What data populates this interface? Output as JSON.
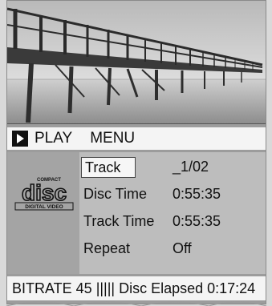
{
  "transport": {
    "state_label": "PLAY",
    "menu_label": "MENU",
    "state_icon": "play-icon"
  },
  "logo": {
    "top_text": "COMPACT",
    "main_text": "disc",
    "bottom_text": "DIGITAL VIDEO"
  },
  "info": {
    "rows": [
      {
        "label": "Track",
        "value": "_1/02"
      },
      {
        "label": "Disc Time",
        "value": "0:55:35"
      },
      {
        "label": "Track Time",
        "value": "0:55:35"
      },
      {
        "label": "Repeat",
        "value": "Off"
      }
    ]
  },
  "status": {
    "text": "BITRATE 45 ||||| Disc Elapsed  0:17:24"
  },
  "colors": {
    "panel_bg": "#bdbdbd",
    "bar_bg": "#f4f4f4",
    "selection_border": "#444444"
  }
}
